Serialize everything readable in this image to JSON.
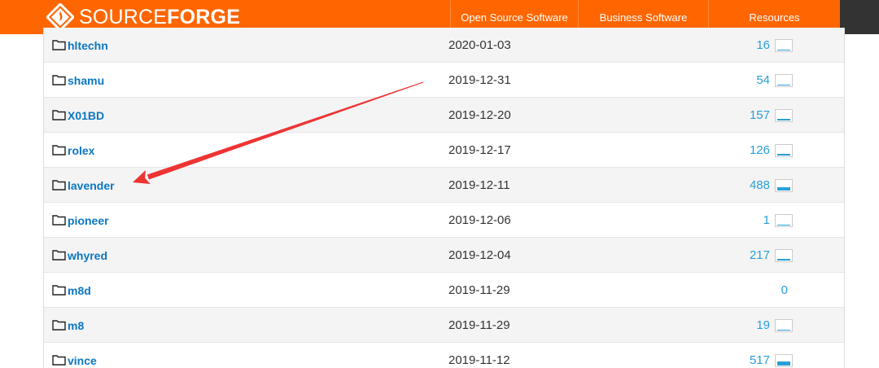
{
  "brand": {
    "name_light": "SOURCE",
    "name_bold": "FORGE",
    "bar_color": "#ff6600",
    "link_color": "#0b77c2",
    "count_color": "#2a9fd8"
  },
  "nav": {
    "items": [
      {
        "label": "Open Source Software"
      },
      {
        "label": "Business Software"
      },
      {
        "label": "Resources"
      }
    ]
  },
  "files": {
    "rows": [
      {
        "name": "hltechn",
        "date": "2020-01-03",
        "downloads": "16",
        "sparkline": true,
        "sparkline_level": 0.1
      },
      {
        "name": "shamu",
        "date": "2019-12-31",
        "downloads": "54",
        "sparkline": true,
        "sparkline_level": 0.1
      },
      {
        "name": "X01BD",
        "date": "2019-12-20",
        "downloads": "157",
        "sparkline": true,
        "sparkline_level": 0.2
      },
      {
        "name": "rolex",
        "date": "2019-12-17",
        "downloads": "126",
        "sparkline": true,
        "sparkline_level": 0.2
      },
      {
        "name": "lavender",
        "date": "2019-12-11",
        "downloads": "488",
        "sparkline": true,
        "sparkline_level": 0.3
      },
      {
        "name": "pioneer",
        "date": "2019-12-06",
        "downloads": "1",
        "sparkline": true,
        "sparkline_level": 0.0
      },
      {
        "name": "whyred",
        "date": "2019-12-04",
        "downloads": "217",
        "sparkline": true,
        "sparkline_level": 0.2
      },
      {
        "name": "m8d",
        "date": "2019-11-29",
        "downloads": "0",
        "sparkline": false,
        "sparkline_level": 0.0
      },
      {
        "name": "m8",
        "date": "2019-11-29",
        "downloads": "19",
        "sparkline": true,
        "sparkline_level": 0.1
      },
      {
        "name": "vince",
        "date": "2019-11-12",
        "downloads": "517",
        "sparkline": true,
        "sparkline_level": 0.4
      }
    ]
  },
  "annotation": {
    "arrow_color": "#ee3333",
    "points_to": "lavender"
  }
}
